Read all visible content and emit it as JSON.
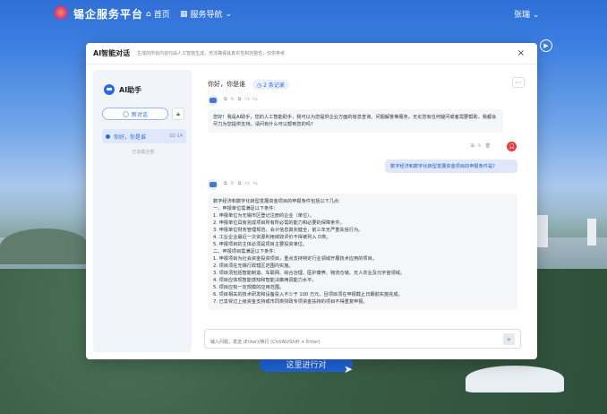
{
  "nav": {
    "brand": "锡企服务平台",
    "home": "首页",
    "service": "服务导航",
    "user": "张瑞"
  },
  "modal": {
    "title": "AI智能对话",
    "subtitle": "生成的所有内容均由人工智能生成，无法确保其真实性和完整性，仅供参考",
    "close": "×"
  },
  "sidebar": {
    "assistant": "AI助手",
    "new_chat": "新对话",
    "session_title": "你好，你是谁",
    "session_time": "02-14",
    "loaded": "已加载全部"
  },
  "chat": {
    "greet": "你好，你是谁",
    "records": "2 条记录",
    "bot_intro": "您好！我是AI助手，您的人工智能助手，我可以为您提供企业方面的信息查询、问题解答等服务。无论您有任何疑问或者需要帮助，我都会尽力为您提供支持。请问有什么可以帮到您的吗？",
    "user_question": "数字经济和数字化转型发展资金项目的申报条件是?",
    "answer_lines": [
      "数字经济和数字化转型发展资金项目的申报条件包括以下几点:",
      "一、申报单位需满足以下条件：",
      "1. 申报单位为无锡市区登记注册的企业（单位）。",
      "2. 申报单位具有完成项目所有所必需的能力和必要的保障条件。",
      "3. 申报单位财务管理规范，会计信息真实健全，前三年无严重失信行为。",
      "4. 工业企业最近一次资源利用绩效评价不得被列入 D类。",
      "5. 申报项目的主体必须是项目主要投资单位。",
      "二、申报项目需满足以下条件：",
      "1. 申报项目为社会资金投资项目，重点支持特定行业领域开展技术应用的项目。",
      "2. 项目须在无锡行政辖区范围内实施。",
      "3. 项目须包括智能制造、车联网、综合治理、医护康养、物流仓储、无人农业及元宇宙领域。",
      "4. 项目应体现智能感知和智能决策两调能力水平。",
      "5. 项目应有一定规模的应用范围。",
      "6. 项目相关的技术研发和设备投入不少于 100 万元，且项目须在申报截止日期前实施完成。",
      "7. 已享受过上级资金支持或市同类财政专项资金扶持的项目不得重复申报。"
    ],
    "input_placeholder": "输入问题，发送 (Enter)/换行 (Ctrl/Alt/Shift + Enter)"
  },
  "cta": {
    "label": "这里进行对"
  },
  "colors": {
    "primary": "#2b6be0",
    "accent_red": "#e0413f"
  }
}
